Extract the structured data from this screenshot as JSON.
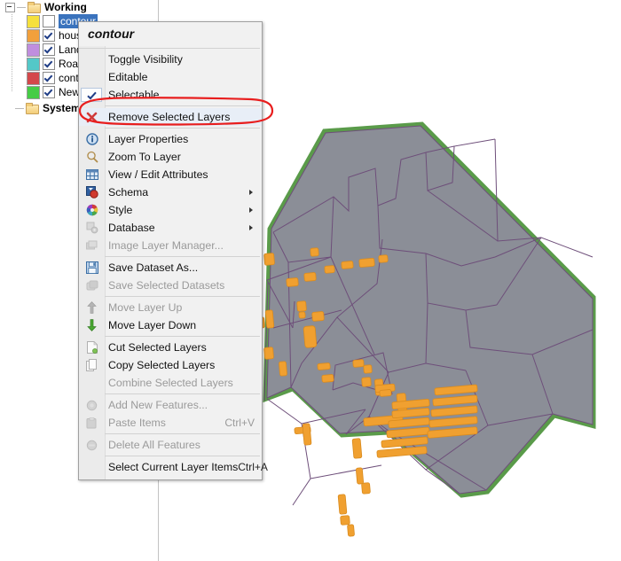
{
  "tree": {
    "root_nodes": [
      {
        "label": "Working",
        "icon": "folder-icon",
        "expanded": true
      },
      {
        "label": "System",
        "icon": "folder-icon",
        "expanded": true
      }
    ],
    "layers": [
      {
        "label": "contour",
        "swatch": "#f5e03c",
        "checked": false,
        "selected": true
      },
      {
        "label": "house",
        "swatch": "#f2a03c",
        "checked": true,
        "selected": false
      },
      {
        "label": "Land",
        "swatch": "#c08ede",
        "checked": true,
        "selected": false
      },
      {
        "label": "Road",
        "swatch": "#54c8c8",
        "checked": true,
        "selected": false
      },
      {
        "label": "conto",
        "swatch": "#d4484b",
        "checked": true,
        "selected": false
      },
      {
        "label": "New",
        "swatch": "#46cc46",
        "checked": true,
        "selected": false
      }
    ]
  },
  "context_menu": {
    "title": "contour",
    "groups": [
      {
        "items": [
          {
            "label": "Toggle Visibility",
            "icon": "none-icon",
            "enabled": true,
            "accel": "",
            "submenu": false,
            "checked": false
          },
          {
            "label": "Editable",
            "icon": "none-icon",
            "enabled": true,
            "accel": "",
            "submenu": false,
            "checked": false
          },
          {
            "label": "Selectable",
            "icon": "check-icon",
            "enabled": true,
            "accel": "",
            "submenu": false,
            "checked": true
          }
        ]
      },
      {
        "items": [
          {
            "label": "Remove Selected Layers",
            "icon": "red-x-icon",
            "enabled": true,
            "accel": "",
            "submenu": false,
            "highlighted": true
          }
        ]
      },
      {
        "items": [
          {
            "label": "Layer Properties",
            "icon": "info-icon",
            "enabled": true,
            "accel": "",
            "submenu": false
          },
          {
            "label": "Zoom To Layer",
            "icon": "magnifier-icon",
            "enabled": true,
            "accel": "",
            "submenu": false
          },
          {
            "label": "View / Edit Attributes",
            "icon": "table-icon",
            "enabled": true,
            "accel": "",
            "submenu": false
          },
          {
            "label": "Schema",
            "icon": "schema-icon",
            "enabled": true,
            "accel": "",
            "submenu": true
          },
          {
            "label": "Style",
            "icon": "color-wheel-icon",
            "enabled": true,
            "accel": "",
            "submenu": true
          },
          {
            "label": "Database",
            "icon": "database-gear-icon",
            "enabled": true,
            "accel": "",
            "submenu": true
          },
          {
            "label": "Image Layer Manager...",
            "icon": "image-layer-icon",
            "enabled": false,
            "accel": "",
            "submenu": false
          }
        ]
      },
      {
        "items": [
          {
            "label": "Save Dataset As...",
            "icon": "floppy-icon",
            "enabled": true,
            "accel": "",
            "submenu": false
          },
          {
            "label": "Save Selected Datasets",
            "icon": "save-stack-icon",
            "enabled": false,
            "accel": "",
            "submenu": false
          }
        ]
      },
      {
        "items": [
          {
            "label": "Move Layer Up",
            "icon": "arrow-up-icon",
            "enabled": false,
            "accel": "",
            "submenu": false
          },
          {
            "label": "Move Layer Down",
            "icon": "arrow-down-icon",
            "enabled": true,
            "accel": "",
            "submenu": false
          }
        ]
      },
      {
        "items": [
          {
            "label": "Cut Selected Layers",
            "icon": "cut-page-icon",
            "enabled": true,
            "accel": "",
            "submenu": false
          },
          {
            "label": "Copy Selected Layers",
            "icon": "copy-pages-icon",
            "enabled": true,
            "accel": "",
            "submenu": false
          },
          {
            "label": "Combine Selected Layers",
            "icon": "none-icon",
            "enabled": false,
            "accel": "",
            "submenu": false
          }
        ]
      },
      {
        "items": [
          {
            "label": "Add New Features...",
            "icon": "add-feature-icon",
            "enabled": false,
            "accel": "",
            "submenu": false
          },
          {
            "label": "Paste Items",
            "icon": "paste-icon",
            "enabled": false,
            "accel": "Ctrl+V",
            "submenu": false
          }
        ]
      },
      {
        "items": [
          {
            "label": "Delete All Features",
            "icon": "delete-feature-icon",
            "enabled": false,
            "accel": "",
            "submenu": false
          }
        ]
      },
      {
        "items": [
          {
            "label": "Select Current Layer Items",
            "icon": "none-icon",
            "enabled": true,
            "accel": "Ctrl+A",
            "submenu": false
          }
        ]
      }
    ]
  },
  "annotation": {
    "shape": "hand-drawn-ellipse",
    "color": "#e81e1e",
    "target": "Remove Selected Layers"
  },
  "map": {
    "colors": {
      "parcel_fill": "#8b8e97",
      "parcel_outline": "#6e4f7a",
      "boundary_green": "#5a9b4a",
      "building_fill": "#f0a030",
      "building_outline": "#d98b1e",
      "background": "#ffffff"
    }
  }
}
